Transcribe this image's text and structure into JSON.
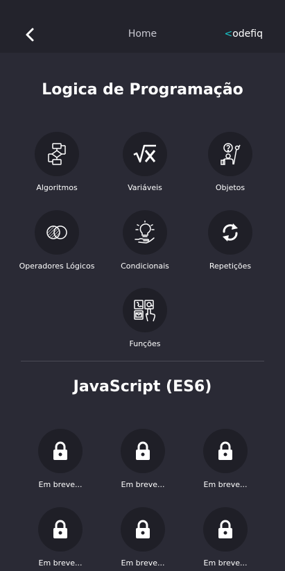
{
  "header": {
    "title": "Home",
    "logo_bracket": "<",
    "logo_text": "odefiq"
  },
  "sections": [
    {
      "title": "Logica de Programação",
      "items": [
        {
          "label": "Algoritmos",
          "icon": "flowchart-icon"
        },
        {
          "label": "Variáveis",
          "icon": "sqrt-x-icon"
        },
        {
          "label": "Objetos",
          "icon": "question-person-icon"
        },
        {
          "label": "Operadores Lógicos",
          "icon": "venn-diagram-icon"
        },
        {
          "label": "Condicionais",
          "icon": "lightbulb-hand-icon"
        },
        {
          "label": "Repetições",
          "icon": "repeat-arrows-icon"
        },
        {
          "label": "Funções",
          "icon": "functions-grid-icon"
        }
      ]
    },
    {
      "title": "JavaScript (ES6)",
      "items": [
        {
          "label": "Em breve...",
          "icon": "lock-icon"
        },
        {
          "label": "Em breve...",
          "icon": "lock-icon"
        },
        {
          "label": "Em breve...",
          "icon": "lock-icon"
        },
        {
          "label": "Em breve...",
          "icon": "lock-icon"
        },
        {
          "label": "Em breve...",
          "icon": "lock-icon"
        },
        {
          "label": "Em breve...",
          "icon": "lock-icon"
        }
      ]
    }
  ],
  "colors": {
    "background": "#2a2a35",
    "header": "#23232c",
    "circle": "#1f1f27",
    "accent": "#18c6c9"
  }
}
